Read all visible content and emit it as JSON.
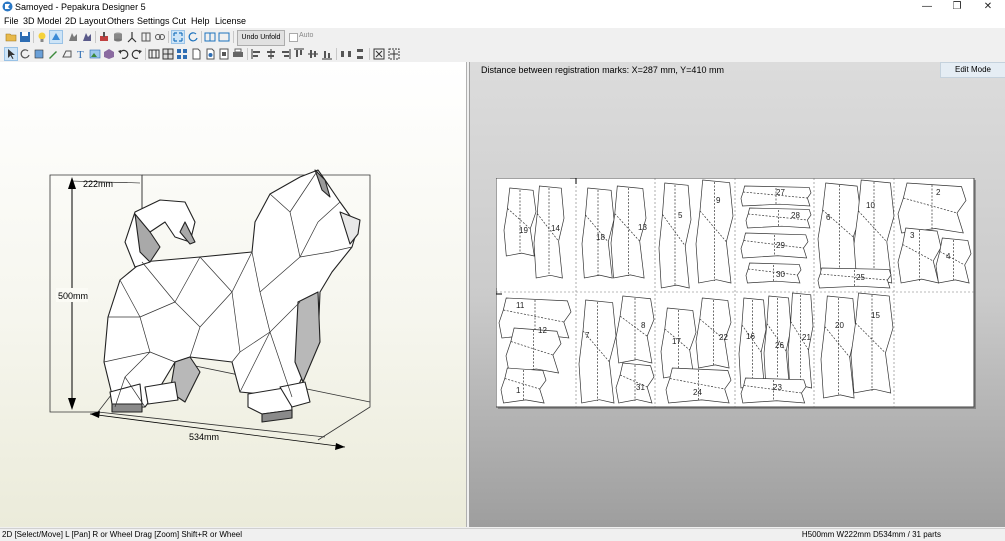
{
  "window": {
    "title": "Samoyed - Pepakura Designer 5",
    "controls": {
      "minimize": "—",
      "restore": "❐",
      "close": "✕"
    }
  },
  "menu": [
    "File",
    "3D Model",
    "2D Layout",
    "Others",
    "Settings",
    "Cut",
    "Help",
    "License"
  ],
  "toolbar": {
    "undo_unfold": "Undo Unfold",
    "auto_label": "Auto",
    "auto_checked": false
  },
  "view3d": {
    "dim_height": "500mm",
    "dim_width": "222mm",
    "dim_depth": "534mm"
  },
  "view2d": {
    "registration_info": "Distance between registration marks: X=287 mm, Y=410 mm",
    "edit_mode": "Edit Mode",
    "part_labels": [
      "19",
      "14",
      "18",
      "13",
      "5",
      "9",
      "27",
      "28",
      "29",
      "30",
      "6",
      "10",
      "25",
      "2",
      "3",
      "4",
      "11",
      "12",
      "1",
      "7",
      "8",
      "31",
      "17",
      "22",
      "24",
      "16",
      "26",
      "21",
      "23",
      "20",
      "15"
    ]
  },
  "status": {
    "left": "2D [Select/Move] L [Pan] R or Wheel Drag [Zoom] Shift+R or Wheel",
    "right": "H500mm W222mm D534mm / 31 parts"
  },
  "colors": {
    "accent": "#1e73be",
    "panel_bg": "#f0f0f0",
    "paper": "#ffffff"
  }
}
